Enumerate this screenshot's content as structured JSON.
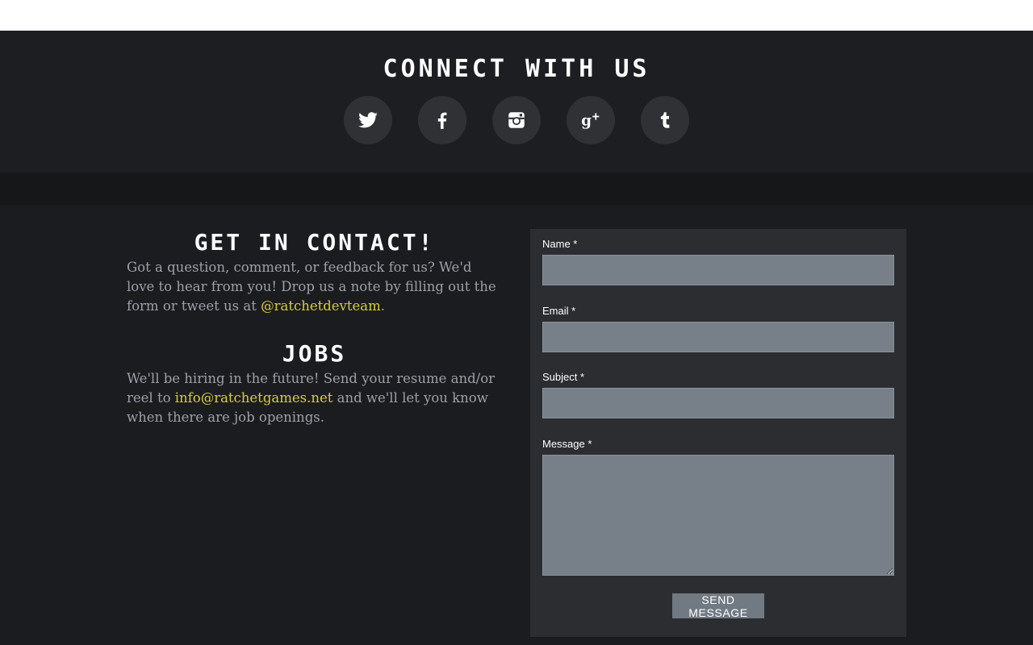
{
  "connect": {
    "title": "CONNECT WITH US",
    "socials": [
      {
        "name": "twitter-icon"
      },
      {
        "name": "facebook-icon"
      },
      {
        "name": "instagram-icon"
      },
      {
        "name": "google-plus-icon"
      },
      {
        "name": "tumblr-icon"
      }
    ]
  },
  "contact": {
    "heading": "GET IN CONTACT!",
    "text_before": "Got a question, comment, or feedback for us? We'd love to hear from you! Drop us a note by filling out the form or tweet us at ",
    "handle": "@ratchetdevteam",
    "text_after": "."
  },
  "jobs": {
    "heading": "JOBS",
    "text_before": "We'll be hiring in the future! Send your resume and/or reel to ",
    "email": "info@ratchetgames.net",
    "text_after": " and we'll let you know when there are job openings."
  },
  "form": {
    "name_label": "Name *",
    "email_label": "Email *",
    "subject_label": "Subject *",
    "message_label": "Message *",
    "name_value": "",
    "email_value": "",
    "subject_value": "",
    "message_value": "",
    "submit_label": "SEND MESSAGE"
  },
  "colors": {
    "background": "#1b1c20",
    "link": "#d7ce3c",
    "field": "#778089"
  }
}
